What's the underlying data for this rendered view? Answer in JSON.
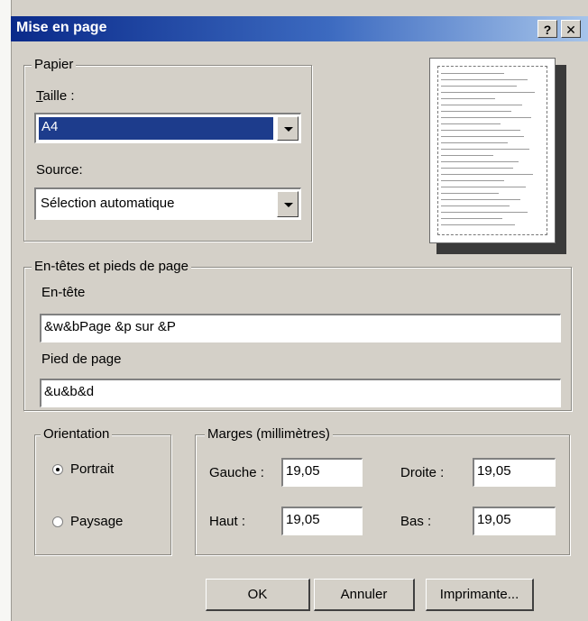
{
  "window": {
    "title": "Mise en page",
    "help_button": "?",
    "close_button": "✕"
  },
  "paper": {
    "legend": "Papier",
    "size_label": "Taille :",
    "size_value": "A4",
    "source_label": "Source:",
    "source_value": "Sélection automatique"
  },
  "headers": {
    "legend": "En-têtes et pieds de page",
    "header_label": "En-tête",
    "header_value": "&w&bPage &p sur &P",
    "footer_label": "Pied de page",
    "footer_value": "&u&b&d"
  },
  "orientation": {
    "legend": "Orientation",
    "portrait_label": "Portrait",
    "landscape_label": "Paysage",
    "selected": "portrait"
  },
  "margins": {
    "legend": "Marges (millimètres)",
    "left_label": "Gauche :",
    "left_value": "19,05",
    "right_label": "Droite :",
    "right_value": "19,05",
    "top_label": "Haut :",
    "top_value": "19,05",
    "bottom_label": "Bas :",
    "bottom_value": "19,05"
  },
  "buttons": {
    "ok": "OK",
    "cancel": "Annuler",
    "printer": "Imprimante..."
  },
  "colors": {
    "titlebar_start": "#0a2a8a",
    "titlebar_end": "#a6c4ea",
    "selection": "#1d3c8c",
    "dialog_bg": "#d4d0c8"
  }
}
